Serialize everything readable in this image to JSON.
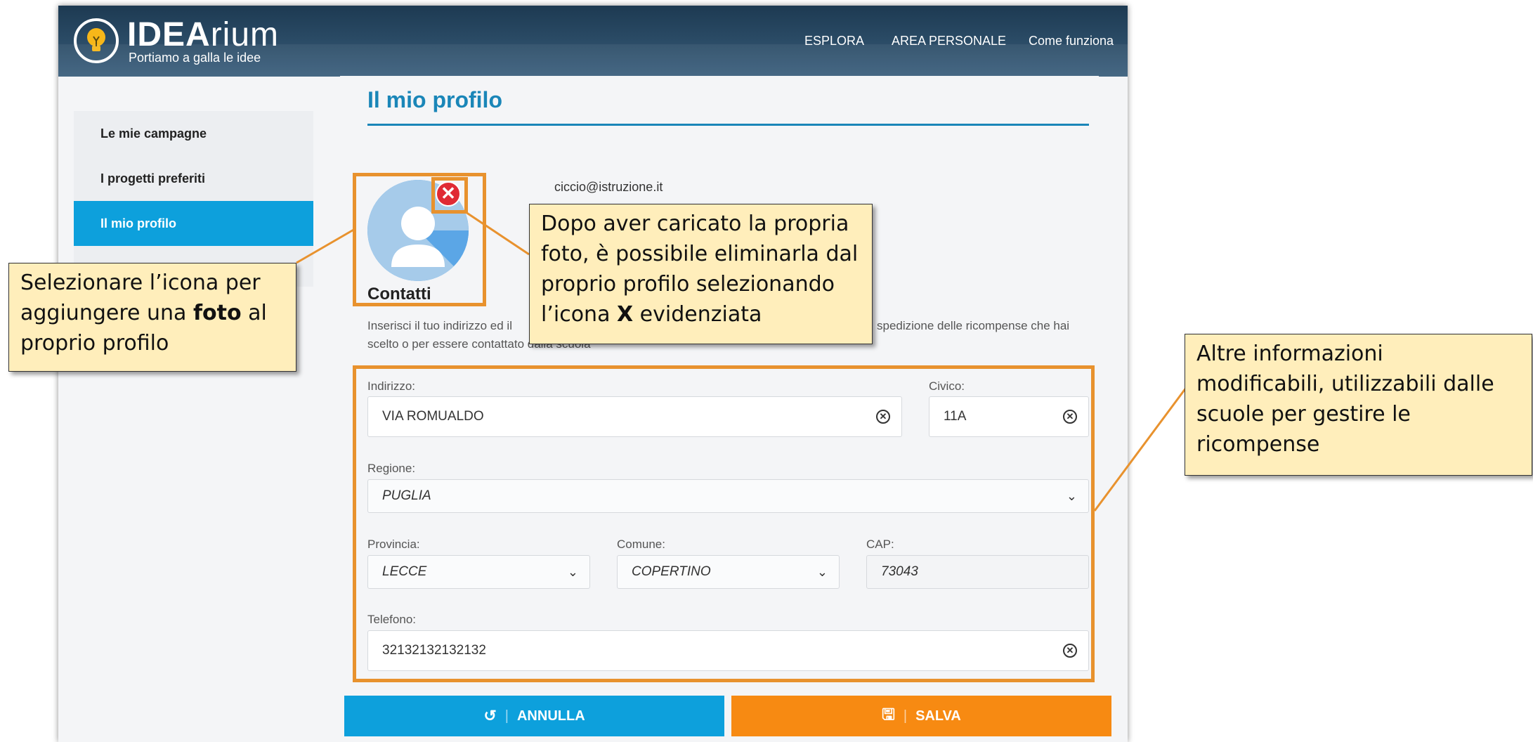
{
  "header": {
    "brand_bold": "IDEA",
    "brand_light": "rium",
    "tagline": "Portiamo a galla le idee",
    "nav": [
      "ESPLORA",
      "AREA PERSONALE",
      "Come funziona"
    ]
  },
  "sidebar": {
    "items": [
      {
        "label": "Le mie campagne"
      },
      {
        "label": "I progetti preferiti"
      },
      {
        "label": "Il mio profilo"
      }
    ]
  },
  "profile": {
    "title": "Il mio profilo",
    "email": "ciccio@istruzione.it",
    "delete_glyph": "✕"
  },
  "contacts": {
    "heading": "Contatti",
    "intro_start": "Inserisci il tuo indirizzo ed il",
    "intro_end": "spedizione delle ricompense che hai",
    "intro_line2": "scelto o per essere contattato dalla scuola",
    "indirizzo_label": "Indirizzo:",
    "indirizzo_value": "VIA ROMUALDO",
    "civico_label": "Civico:",
    "civico_value": "11A",
    "regione_label": "Regione:",
    "regione_value": "PUGLIA",
    "provincia_label": "Provincia:",
    "provincia_value": "LECCE",
    "comune_label": "Comune:",
    "comune_value": "COPERTINO",
    "cap_label": "CAP:",
    "cap_value": "73043",
    "telefono_label": "Telefono:",
    "telefono_value": "32132132132132"
  },
  "buttons": {
    "annulla": "ANNULLA",
    "salva": "SALVA"
  },
  "callouts": {
    "photo_a": "Selezionare l’icona per",
    "photo_b1": "aggiungere una ",
    "photo_b2": "foto",
    "photo_b3": " al",
    "photo_c": "proprio profilo",
    "delete_a": "Dopo aver caricato la propria",
    "delete_b": "foto, è possibile eliminarla dal",
    "delete_c": "proprio profilo selezionando",
    "delete_d1": "l’icona ",
    "delete_d2": "X",
    "delete_d3": " evidenziata",
    "other_a": "Altre informazioni",
    "other_b": "modificabili, utilizzabili dalle",
    "other_c": "scuole per gestire le",
    "other_d": "ricompense"
  },
  "colors": {
    "header": "#2c4d68",
    "accent_blue": "#0da0dc",
    "title_blue": "#1a86b8",
    "salva_orange": "#f78a12",
    "highlight": "#e8922e",
    "callout_bg": "#ffeebb"
  }
}
